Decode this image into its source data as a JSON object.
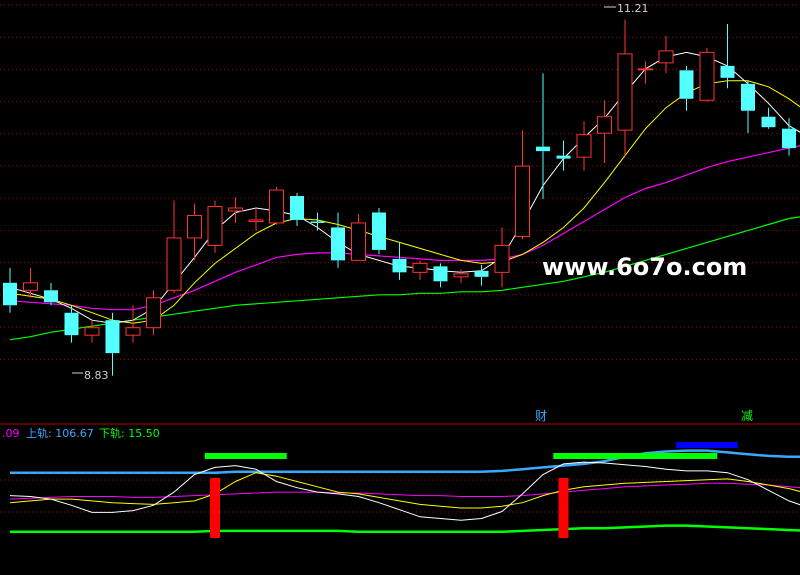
{
  "price_panel": {
    "high_label": "11.21",
    "low_label": "8.83"
  },
  "markers": {
    "cai": "财",
    "jian": "减"
  },
  "watermark": "www.6o7o.com",
  "indicator_legend": {
    "first_value": ".09",
    "upper_label": "上轨: 106.67",
    "lower_label": "下轨: 15.50"
  },
  "colors": {
    "grid": "#b00000",
    "up_candle": "#ff3232",
    "down_candle": "#54ffff",
    "ma_white": "#ffffff",
    "ma_yellow": "#ffff00",
    "ma_magenta": "#ff00ff",
    "ma_green": "#00ff00",
    "upper_band": "#3aa8ff",
    "lower_band": "#00ff00",
    "signal_red": "#ff0000",
    "signal_green": "#00ff00",
    "signal_blue": "#0000ff"
  },
  "chart_data": {
    "type": "candlestick",
    "ylim": [
      8.6,
      11.3
    ],
    "candles": [
      {
        "open": 9.45,
        "close": 9.3,
        "high": 9.55,
        "low": 9.25
      },
      {
        "open": 9.4,
        "close": 9.45,
        "high": 9.55,
        "low": 9.35
      },
      {
        "open": 9.4,
        "close": 9.32,
        "high": 9.45,
        "low": 9.3
      },
      {
        "open": 9.25,
        "close": 9.1,
        "high": 9.3,
        "low": 9.05
      },
      {
        "open": 9.1,
        "close": 9.15,
        "high": 9.2,
        "low": 9.05
      },
      {
        "open": 9.2,
        "close": 8.98,
        "high": 9.25,
        "low": 8.83
      },
      {
        "open": 9.1,
        "close": 9.15,
        "high": 9.3,
        "low": 9.05
      },
      {
        "open": 9.15,
        "close": 9.35,
        "high": 9.4,
        "low": 9.1
      },
      {
        "open": 9.4,
        "close": 9.75,
        "high": 10.0,
        "low": 9.38
      },
      {
        "open": 9.75,
        "close": 9.9,
        "high": 9.98,
        "low": 9.6
      },
      {
        "open": 9.7,
        "close": 9.96,
        "high": 10.0,
        "low": 9.65
      },
      {
        "open": 9.93,
        "close": 9.95,
        "high": 10.02,
        "low": 9.85
      },
      {
        "open": 9.86,
        "close": 9.87,
        "high": 9.95,
        "low": 9.8
      },
      {
        "open": 9.85,
        "close": 10.07,
        "high": 10.09,
        "low": 9.84
      },
      {
        "open": 10.03,
        "close": 9.87,
        "high": 10.05,
        "low": 9.83
      },
      {
        "open": 9.86,
        "close": 9.85,
        "high": 9.92,
        "low": 9.8
      },
      {
        "open": 9.82,
        "close": 9.6,
        "high": 9.92,
        "low": 9.55
      },
      {
        "open": 9.6,
        "close": 9.85,
        "high": 9.91,
        "low": 9.6
      },
      {
        "open": 9.92,
        "close": 9.67,
        "high": 9.95,
        "low": 9.64
      },
      {
        "open": 9.61,
        "close": 9.52,
        "high": 9.72,
        "low": 9.47
      },
      {
        "open": 9.52,
        "close": 9.58,
        "high": 9.6,
        "low": 9.47
      },
      {
        "open": 9.56,
        "close": 9.46,
        "high": 9.58,
        "low": 9.42
      },
      {
        "open": 9.49,
        "close": 9.51,
        "high": 9.54,
        "low": 9.45
      },
      {
        "open": 9.53,
        "close": 9.49,
        "high": 9.57,
        "low": 9.43
      },
      {
        "open": 9.52,
        "close": 9.7,
        "high": 9.82,
        "low": 9.42
      },
      {
        "open": 9.76,
        "close": 10.23,
        "high": 10.47,
        "low": 9.74
      },
      {
        "open": 10.36,
        "close": 10.33,
        "high": 10.85,
        "low": 10.01
      },
      {
        "open": 10.3,
        "close": 10.28,
        "high": 10.4,
        "low": 10.2
      },
      {
        "open": 10.29,
        "close": 10.44,
        "high": 10.53,
        "low": 10.2
      },
      {
        "open": 10.45,
        "close": 10.56,
        "high": 10.67,
        "low": 10.25
      },
      {
        "open": 10.47,
        "close": 10.98,
        "high": 11.21,
        "low": 10.3
      },
      {
        "open": 10.88,
        "close": 10.88,
        "high": 10.93,
        "low": 10.78
      },
      {
        "open": 10.92,
        "close": 11.0,
        "high": 11.1,
        "low": 10.85
      },
      {
        "open": 10.87,
        "close": 10.68,
        "high": 10.9,
        "low": 10.6
      },
      {
        "open": 10.67,
        "close": 10.99,
        "high": 11.02,
        "low": 10.66
      },
      {
        "open": 10.9,
        "close": 10.82,
        "high": 11.18,
        "low": 10.75
      },
      {
        "open": 10.78,
        "close": 10.6,
        "high": 10.8,
        "low": 10.45
      },
      {
        "open": 10.56,
        "close": 10.49,
        "high": 10.62,
        "low": 10.48
      },
      {
        "open": 10.48,
        "close": 10.35,
        "high": 10.55,
        "low": 10.3
      },
      {
        "open": 10.33,
        "close": 10.35,
        "high": 10.45,
        "low": 10.31
      }
    ],
    "ma_white": [
      9.42,
      9.38,
      9.34,
      9.28,
      9.2,
      9.18,
      9.2,
      9.28,
      9.45,
      9.62,
      9.8,
      9.92,
      9.95,
      9.93,
      9.9,
      9.82,
      9.72,
      9.64,
      9.6,
      9.56,
      9.55,
      9.53,
      9.52,
      9.53,
      9.62,
      9.85,
      10.1,
      10.28,
      10.42,
      10.55,
      10.72,
      10.88,
      10.96,
      10.99,
      10.96,
      10.9,
      10.78,
      10.65,
      10.5,
      10.42
    ],
    "ma_yellow": [
      9.38,
      9.36,
      9.34,
      9.3,
      9.25,
      9.2,
      9.18,
      9.2,
      9.3,
      9.45,
      9.58,
      9.68,
      9.78,
      9.85,
      9.88,
      9.87,
      9.84,
      9.8,
      9.76,
      9.72,
      9.68,
      9.64,
      9.6,
      9.58,
      9.59,
      9.64,
      9.72,
      9.82,
      9.95,
      10.12,
      10.3,
      10.48,
      10.62,
      10.72,
      10.78,
      10.8,
      10.8,
      10.76,
      10.68,
      10.58
    ],
    "ma_magenta": [
      9.33,
      9.32,
      9.31,
      9.3,
      9.28,
      9.27,
      9.27,
      9.3,
      9.35,
      9.4,
      9.46,
      9.52,
      9.57,
      9.62,
      9.64,
      9.65,
      9.65,
      9.64,
      9.63,
      9.62,
      9.61,
      9.6,
      9.6,
      9.6,
      9.61,
      9.64,
      9.7,
      9.78,
      9.86,
      9.94,
      10.02,
      10.08,
      10.12,
      10.17,
      10.22,
      10.26,
      10.29,
      10.32,
      10.35,
      10.38
    ],
    "ma_green": [
      9.07,
      9.09,
      9.12,
      9.14,
      9.16,
      9.18,
      9.2,
      9.22,
      9.24,
      9.26,
      9.28,
      9.3,
      9.31,
      9.32,
      9.33,
      9.34,
      9.35,
      9.36,
      9.37,
      9.37,
      9.38,
      9.38,
      9.39,
      9.39,
      9.4,
      9.42,
      9.44,
      9.46,
      9.49,
      9.52,
      9.56,
      9.6,
      9.64,
      9.68,
      9.72,
      9.76,
      9.8,
      9.84,
      9.88,
      9.9
    ],
    "indicator": {
      "upper_band": [
        82,
        82,
        82,
        82,
        82,
        82,
        82,
        82,
        82,
        82,
        82,
        83,
        83,
        83,
        83,
        83,
        83,
        83,
        83,
        83,
        83,
        83,
        83,
        83,
        84,
        86,
        88,
        90,
        92,
        95,
        100,
        104,
        106,
        107,
        107,
        105,
        103,
        101,
        100,
        100
      ],
      "lower_band": [
        15,
        15,
        15,
        15,
        15,
        15,
        15,
        15,
        15,
        15,
        16,
        16,
        16,
        16,
        16,
        16,
        16,
        15,
        15,
        15,
        15,
        15,
        15,
        15,
        15,
        16,
        17,
        18,
        19,
        19,
        20,
        21,
        22,
        22,
        21,
        20,
        19,
        18,
        17,
        16
      ],
      "white_line": [
        56,
        55,
        52,
        45,
        37,
        37,
        39,
        45,
        60,
        80,
        88,
        90,
        86,
        72,
        65,
        60,
        58,
        55,
        48,
        40,
        32,
        30,
        28,
        30,
        38,
        58,
        80,
        92,
        94,
        93,
        91,
        89,
        86,
        84,
        84,
        82,
        74,
        62,
        50,
        42
      ],
      "yellow_line": [
        48,
        50,
        52,
        52,
        50,
        48,
        47,
        46,
        48,
        50,
        58,
        72,
        82,
        78,
        72,
        66,
        60,
        58,
        54,
        50,
        46,
        44,
        42,
        42,
        44,
        48,
        56,
        62,
        66,
        68,
        70,
        71,
        72,
        73,
        74,
        75,
        72,
        68,
        64,
        58
      ],
      "magenta_line": [
        52,
        53,
        54,
        55,
        55,
        55,
        54,
        54,
        55,
        56,
        57,
        58,
        59,
        60,
        60,
        60,
        59,
        59,
        58,
        57,
        56,
        56,
        55,
        55,
        55,
        56,
        58,
        60,
        62,
        64,
        66,
        67,
        68,
        69,
        70,
        70,
        69,
        68,
        66,
        64
      ],
      "red_bars": [
        10,
        27
      ],
      "green_bars": [
        [
          9.5,
          13.5
        ],
        [
          26.5,
          34.5
        ]
      ],
      "blue_bar": [
        [
          32.5,
          35.5
        ]
      ]
    }
  }
}
